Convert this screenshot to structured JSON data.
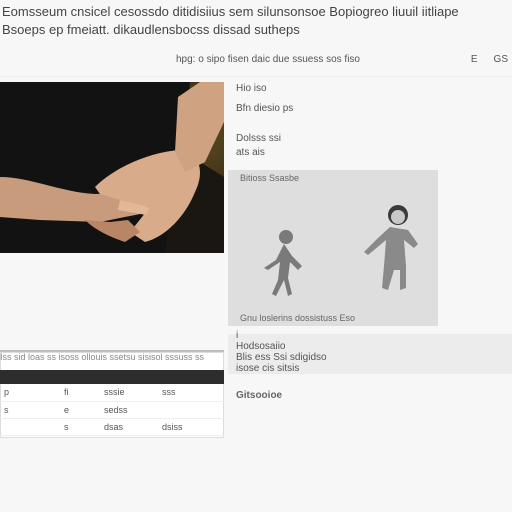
{
  "header": {
    "line1": "Eomsseum cnsicel  cesossdo ditidisiius sem silunsonsoe Bopiogreo liuuil iitliape",
    "line2": "Bsoeps ep fmeiatt.  dikaudlensbocss dissad sutheps"
  },
  "toolbar": {
    "text": "hpg: o sipo fisen daic due ssuess sos  fiso",
    "button_a": "E",
    "button_b": "GS"
  },
  "meta": [
    "Hio iso",
    "Bfn diesio ps",
    "Dolsss ssi",
    "ats ais",
    "Bitioss Ssasbe"
  ],
  "figure": {
    "caption_top": "Bitioss Ssasbe",
    "caption_bottom": "Gnu loslerins dossistuss Eso"
  },
  "side_list": [
    "i",
    "Hodsosaiio",
    "Blis ess Ssi sdigidso",
    "isose cis sitsis",
    "Gitsooioe"
  ],
  "table": {
    "caption": "Iss sid loas ss isoss ollouis ssetsu sisisol sssuss ss",
    "rows": [
      [
        "p",
        "fi",
        "sssie",
        "sss"
      ],
      [
        "s",
        "e",
        "sedss",
        ""
      ],
      [
        "",
        "s",
        "dsas",
        "dsiss"
      ]
    ]
  },
  "colors": {
    "background": "#f7f7f7",
    "figure_bg": "#dedede",
    "table_header": "#2d2d2d",
    "photo_bg": "#1d1a14"
  }
}
